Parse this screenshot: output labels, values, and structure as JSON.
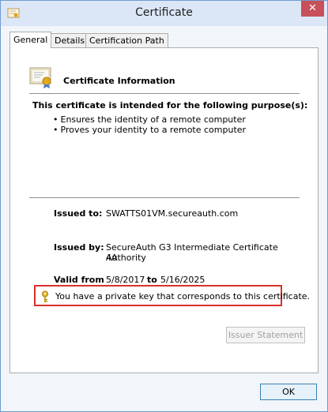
{
  "window": {
    "title": "Certificate",
    "close_glyph": "✕"
  },
  "tabs": [
    {
      "label": "General",
      "active": true
    },
    {
      "label": "Details",
      "active": false
    },
    {
      "label": "Certification Path",
      "active": false
    }
  ],
  "info": {
    "title": "Certificate Information",
    "purpose_heading": "This certificate is intended for the following purpose(s):",
    "purposes": [
      "Ensures the identity of a remote computer",
      "Proves your identity to a remote computer"
    ]
  },
  "fields": {
    "issued_to_label": "Issued to:",
    "issued_to_value": "SWATTS01VM.secureauth.com",
    "issued_by_label": "Issued by:",
    "issued_by_value_line1": "SecureAuth G3 Intermediate Certificate Authority",
    "issued_by_value_line2": "4A",
    "valid_from_label": "Valid from",
    "valid_from_value": "5/8/2017",
    "valid_to_label": "to",
    "valid_to_value": "5/16/2025"
  },
  "private_key_text": "You have a private key that corresponds to this certificate.",
  "buttons": {
    "issuer_statement": "Issuer Statement",
    "ok": "OK"
  },
  "colors": {
    "highlight": "#d9312b",
    "titlebar": "#dbe7f6",
    "close": "#c7505a"
  },
  "icons": [
    "certificate-app-icon",
    "close-icon",
    "certificate-icon",
    "key-icon"
  ]
}
